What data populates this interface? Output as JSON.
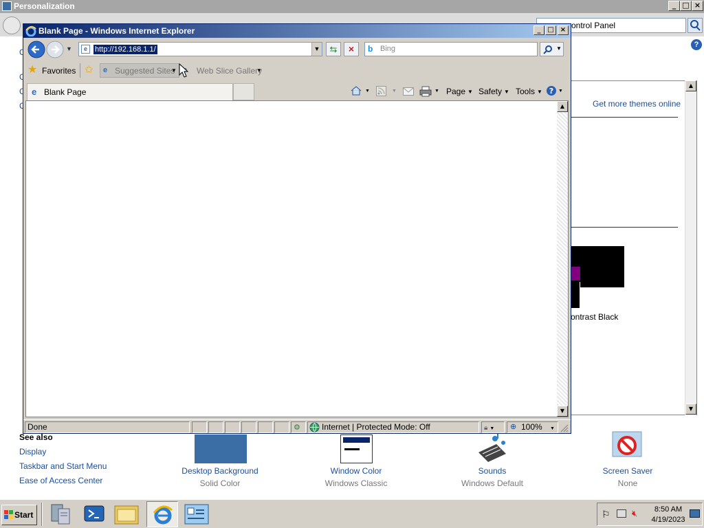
{
  "background_window": {
    "title": "Personalization",
    "address_value": "ontrol Panel",
    "get_more_themes": "Get more themes online",
    "theme_name_partial": "ontrast Black",
    "see_also_heading": "See also",
    "see_also_links": [
      "Display",
      "Taskbar and Start Menu",
      "Ease of Access Center"
    ],
    "settings": [
      {
        "label": "Desktop Background",
        "value": "Solid Color"
      },
      {
        "label": "Window Color",
        "value": "Windows Classic"
      },
      {
        "label": "Sounds",
        "value": "Windows Default"
      },
      {
        "label": "Screen Saver",
        "value": "None"
      }
    ],
    "left_partial_letters": [
      "C",
      "C",
      "C",
      "C"
    ]
  },
  "ie": {
    "title": "Blank Page - Windows Internet Explorer",
    "address": "http://192.168.1.1/",
    "search_placeholder": "Bing",
    "favorites_label": "Favorites",
    "suggested_sites": "Suggested Sites",
    "web_slice_gallery": "Web Slice Gallery",
    "tab_title": "Blank Page",
    "command_bar": {
      "page": "Page",
      "safety": "Safety",
      "tools": "Tools"
    },
    "status": {
      "text": "Done",
      "zone": "Internet | Protected Mode: Off",
      "zoom": "100%"
    }
  },
  "taskbar": {
    "start_label": "Start",
    "clock_time": "8:50 AM",
    "clock_date": "4/19/2023"
  },
  "colors": {
    "titlebar_active": "#0a246a",
    "desktop_bg_swatch": "#3a6ea5",
    "link": "#1a4d9c"
  }
}
